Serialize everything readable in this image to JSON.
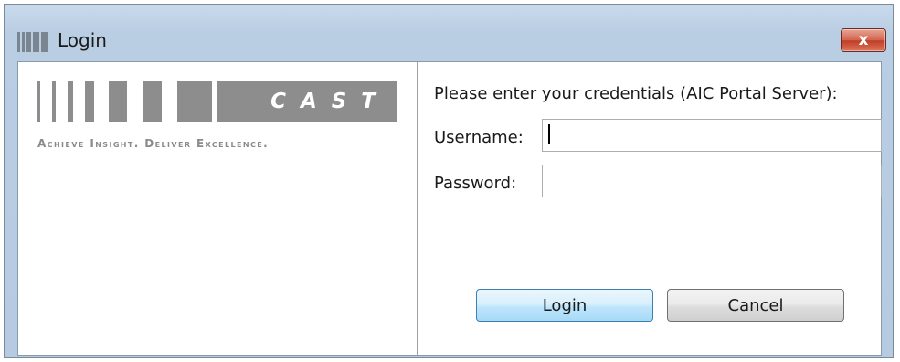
{
  "window": {
    "title": "Login",
    "close_symbol": "x"
  },
  "branding": {
    "logo_word": "CAST",
    "tagline": "Achieve Insight. Deliver Excellence."
  },
  "form": {
    "prompt": "Please enter your credentials (AIC Portal Server):",
    "username_label": "Username:",
    "username_value": "",
    "password_label": "Password:",
    "password_value": ""
  },
  "buttons": {
    "login": "Login",
    "cancel": "Cancel"
  },
  "colors": {
    "titlebar": "#b9cde3",
    "close_button": "#c23b23",
    "logo_gray": "#8d8d8d",
    "login_button_border": "#3c7fb1"
  }
}
